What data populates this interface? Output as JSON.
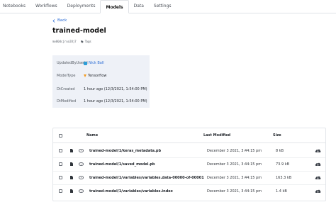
{
  "tabs": [
    {
      "label": "Notebooks",
      "active": false
    },
    {
      "label": "Workflows",
      "active": false
    },
    {
      "label": "Deployments",
      "active": false
    },
    {
      "label": "Models",
      "active": true
    },
    {
      "label": "Data",
      "active": false
    },
    {
      "label": "Settings",
      "active": false
    }
  ],
  "back_label": "Back",
  "model": {
    "title": "trained-model",
    "id": "mo00dcjruo28j7",
    "tags_label": "Tags"
  },
  "properties": [
    {
      "key": "UpdatedByUserId",
      "value": "Nick Ball",
      "icon": "user-square-icon",
      "link": true
    },
    {
      "key": "ModelType",
      "value": "Tensorflow",
      "icon": "tensorflow-icon",
      "link": false
    },
    {
      "key": "DtCreated",
      "value": "1 hour ago (12/3/2021, 1:54:00 PM)",
      "icon": "",
      "link": false
    },
    {
      "key": "DtModified",
      "value": "1 hour ago (12/3/2021, 1:54:00 PM)",
      "icon": "",
      "link": false
    }
  ],
  "files_table": {
    "columns": [
      "Name",
      "Last Modified",
      "Size"
    ],
    "rows": [
      {
        "name": "trained-model/1/keras_metadata.pb",
        "modified": "December 3 2021, 3:44:15 pm",
        "size": "8 kB"
      },
      {
        "name": "trained-model/1/saved_model.pb",
        "modified": "December 3 2021, 3:44:15 pm",
        "size": "73.9 kB"
      },
      {
        "name": "trained-model/1/variables/variables.data-00000-of-00001",
        "modified": "December 3 2021, 3:44:15 pm",
        "size": "163.3 kB"
      },
      {
        "name": "trained-model/1/variables/variables.index",
        "modified": "December 3 2021, 3:44:15 pm",
        "size": "1.4 kB"
      }
    ]
  },
  "colors": {
    "accent": "#2b6cd4",
    "panel": "#eef1f7",
    "tensorflow": "#f39a1e",
    "user_icon": "#2b9ed8"
  }
}
